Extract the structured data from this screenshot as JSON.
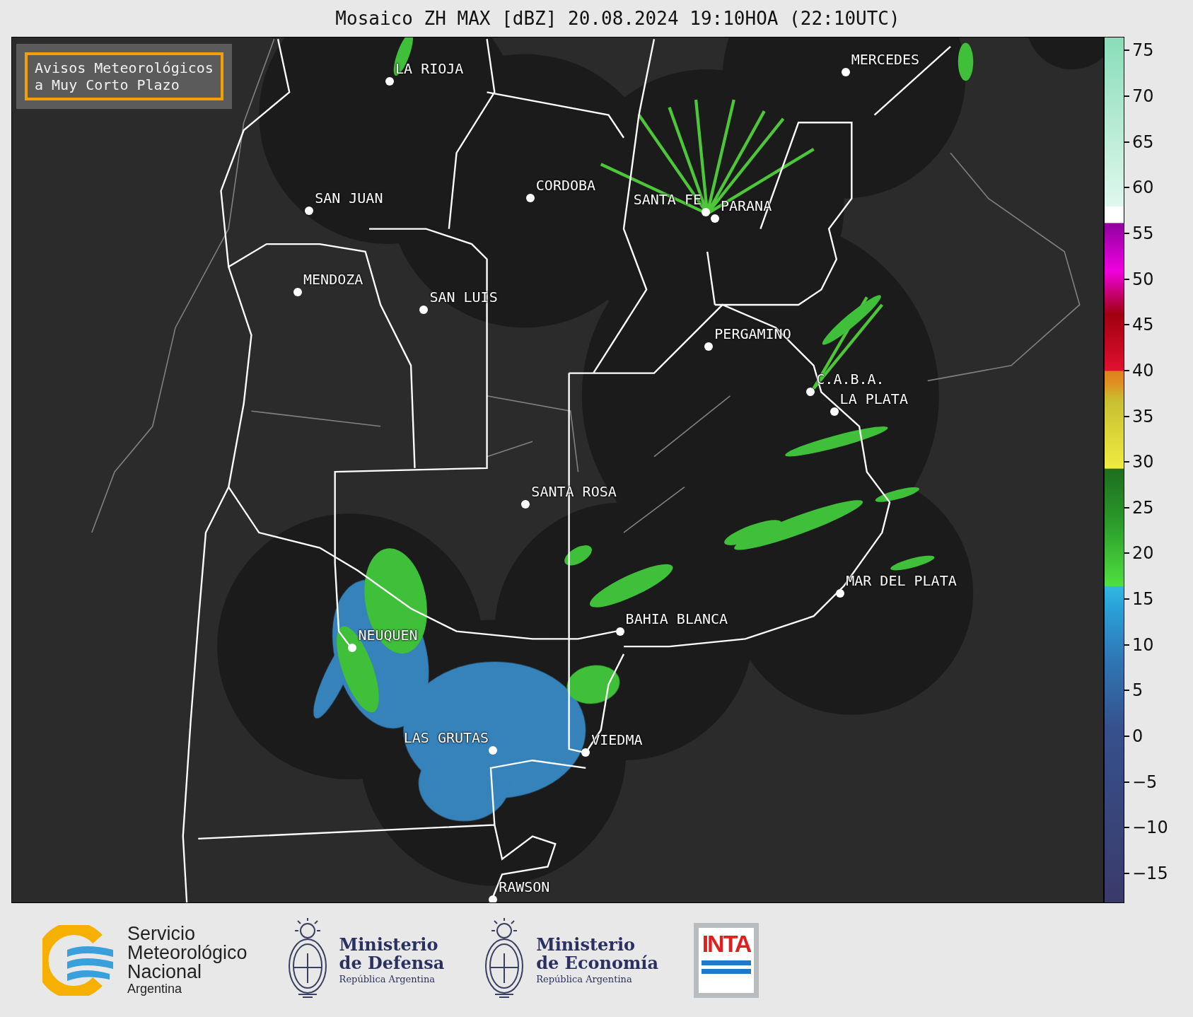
{
  "title": "Mosaico ZH MAX [dBZ] 20.08.2024 19:10HOA (22:10UTC)",
  "notice": {
    "lines": [
      "Avisos Meteorológicos",
      "a Muy Corto Plazo"
    ]
  },
  "cities": [
    {
      "name": "LA RIOJA"
    },
    {
      "name": "MERCEDES"
    },
    {
      "name": "SAN JUAN"
    },
    {
      "name": "CORDOBA"
    },
    {
      "name": "SANTA FE"
    },
    {
      "name": "PARANA"
    },
    {
      "name": "MENDOZA"
    },
    {
      "name": "SAN LUIS"
    },
    {
      "name": "PERGAMINO"
    },
    {
      "name": "C.A.B.A."
    },
    {
      "name": "LA PLATA"
    },
    {
      "name": "SANTA ROSA"
    },
    {
      "name": "MAR DEL PLATA"
    },
    {
      "name": "BAHIA BLANCA"
    },
    {
      "name": "NEUQUEN"
    },
    {
      "name": "LAS GRUTAS"
    },
    {
      "name": "VIEDMA"
    },
    {
      "name": "RAWSON"
    }
  ],
  "colorbar": {
    "ticks": [
      "75",
      "70",
      "65",
      "60",
      "55",
      "50",
      "45",
      "40",
      "35",
      "30",
      "25",
      "20",
      "15",
      "10",
      "5",
      "0",
      "−5",
      "−10",
      "−15"
    ]
  },
  "logos": [
    {
      "kind": "smn",
      "lines": [
        "Servicio",
        "Meteorológico",
        "Nacional",
        "Argentina"
      ]
    },
    {
      "kind": "ministry",
      "lines": [
        "Ministerio",
        "de Defensa",
        "República Argentina"
      ]
    },
    {
      "kind": "ministry",
      "lines": [
        "Ministerio",
        "de Economía",
        "República Argentina"
      ]
    },
    {
      "kind": "inta",
      "lines": [
        "INTA"
      ]
    }
  ]
}
